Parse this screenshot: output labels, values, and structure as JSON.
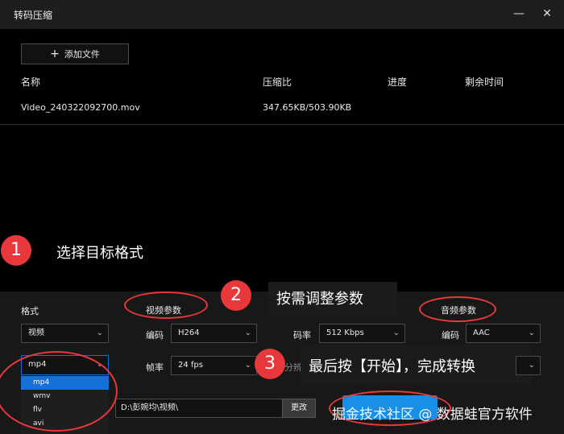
{
  "window": {
    "title": "转码压缩",
    "minimize_icon": "minimize-icon",
    "close_icon": "close-icon"
  },
  "toolbar": {
    "add_label": "添加文件"
  },
  "table": {
    "headers": [
      "名称",
      "压缩比",
      "进度",
      "剩余时间"
    ],
    "rows": [
      {
        "name": "Video_240322092700.mov",
        "ratio": "347.65KB/503.90KB",
        "progress": "",
        "remaining": ""
      }
    ]
  },
  "annotations": {
    "step1_num": "1",
    "step1_text": "选择目标格式",
    "step2_num": "2",
    "step2_text": "按需调整参数",
    "step3_num": "3",
    "step3_text": "最后按【开始】，完成转换",
    "accent_color": "#e8383c"
  },
  "format": {
    "label": "格式",
    "type_value": "视频",
    "format_value": "mp4",
    "options": [
      "mp4",
      "wmv",
      "flv",
      "avi"
    ],
    "selected_option": "mp4"
  },
  "video": {
    "label": "视频参数",
    "codec_label": "编码",
    "codec_value": "H264",
    "framerate_label": "帧率",
    "framerate_value": "24 fps",
    "bitrate_label": "码率",
    "bitrate_value": "512 Kbps",
    "resolution_label_partial": "分辨"
  },
  "audio": {
    "label": "音频参数",
    "codec_label": "编码",
    "codec_value": "AAC"
  },
  "output": {
    "path": "D:\\彭婉均\\视频\\",
    "change_label": "更改"
  },
  "watermark": "掘金技术社区 @ 数据蛙官方软件"
}
